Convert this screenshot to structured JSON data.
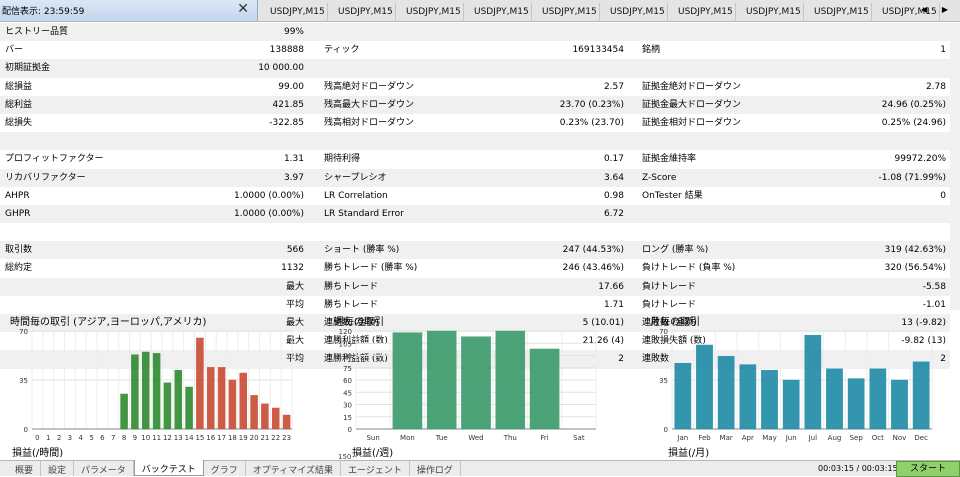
{
  "panel": {
    "title": "配信表示: 23:59:59",
    "close": "✕"
  },
  "chart_tabs": [
    "USDJPY,M15",
    "USDJPY,M15",
    "USDJPY,M15",
    "USDJPY,M15",
    "USDJPY,M15",
    "USDJPY,M15",
    "USDJPY,M15",
    "USDJPY,M15",
    "USDJPY,M15",
    "USDJPY,M15"
  ],
  "tab_arrows": "◀ ▶",
  "stats": {
    "rows": [
      {
        "alt": true,
        "cells": [
          "ヒストリー品質",
          "99%",
          "",
          "",
          "",
          ""
        ],
        "bar": true
      },
      {
        "alt": false,
        "cells": [
          "バー",
          "138888",
          "ティック",
          "169133454",
          "銘柄",
          "1"
        ]
      },
      {
        "alt": true,
        "cells": [
          "初期証拠金",
          "10 000.00",
          "",
          "",
          "",
          ""
        ]
      },
      {
        "alt": false,
        "cells": [
          "総損益",
          "99.00",
          "残高絶対ドローダウン",
          "2.57",
          "証拠金絶対ドローダウン",
          "2.78"
        ]
      },
      {
        "alt": true,
        "cells": [
          "総利益",
          "421.85",
          "残高最大ドローダウン",
          "23.70 (0.23%)",
          "証拠金最大ドローダウン",
          "24.96 (0.25%)"
        ]
      },
      {
        "alt": false,
        "cells": [
          "総損失",
          "-322.85",
          "残高相対ドローダウン",
          "0.23% (23.70)",
          "証拠金相対ドローダウン",
          "0.25% (24.96)"
        ]
      },
      {
        "alt": true,
        "cells": [
          "",
          "",
          "",
          "",
          "",
          ""
        ]
      },
      {
        "alt": false,
        "cells": [
          "プロフィットファクター",
          "1.31",
          "期待利得",
          "0.17",
          "証拠金維持率",
          "99972.20%"
        ]
      },
      {
        "alt": true,
        "cells": [
          "リカバリファクター",
          "3.97",
          "シャープレシオ",
          "3.64",
          "Z-Score",
          "-1.08 (71.99%)"
        ]
      },
      {
        "alt": false,
        "cells": [
          "AHPR",
          "1.0000 (0.00%)",
          "LR Correlation",
          "0.98",
          "OnTester 結果",
          "0"
        ]
      },
      {
        "alt": true,
        "cells": [
          "GHPR",
          "1.0000 (0.00%)",
          "LR Standard Error",
          "6.72",
          "",
          ""
        ]
      },
      {
        "alt": false,
        "cells": [
          "",
          "",
          "",
          "",
          "",
          ""
        ]
      },
      {
        "alt": true,
        "cells": [
          "取引数",
          "566",
          "ショート (勝率 %)",
          "247 (44.53%)",
          "ロング (勝率 %)",
          "319 (42.63%)"
        ]
      },
      {
        "alt": false,
        "cells": [
          "総約定",
          "1132",
          "勝ちトレード (勝率 %)",
          "246 (43.46%)",
          "負けトレード (負率 %)",
          "320 (56.54%)"
        ]
      },
      {
        "alt": true,
        "cells": [
          "",
          "最大",
          "勝ちトレード",
          "17.66",
          "負けトレード",
          "-5.58"
        ]
      },
      {
        "alt": false,
        "cells": [
          "",
          "平均",
          "勝ちトレード",
          "1.71",
          "負けトレード",
          "-1.01"
        ]
      },
      {
        "alt": true,
        "cells": [
          "",
          "最大",
          "連勝数 (金額)",
          "5 (10.01)",
          "連敗数 (金額)",
          "13 (-9.82)"
        ]
      },
      {
        "alt": false,
        "cells": [
          "",
          "最大",
          "連勝利益額 (数)",
          "21.26 (4)",
          "連敗損失額 (数)",
          "-9.82 (13)"
        ]
      },
      {
        "alt": true,
        "cells": [
          "",
          "平均",
          "連勝利益額 (数)",
          "2",
          "連敗数",
          "2"
        ]
      }
    ]
  },
  "chart_data": [
    {
      "type": "bar",
      "title": "時間毎の取引 (アジア,ヨーロッパ,アメリカ)",
      "bottom_label": "損益(/時間)",
      "categories": [
        "0",
        "1",
        "2",
        "3",
        "4",
        "5",
        "6",
        "7",
        "8",
        "9",
        "10",
        "11",
        "12",
        "13",
        "14",
        "15",
        "16",
        "17",
        "18",
        "19",
        "20",
        "21",
        "22",
        "23"
      ],
      "values": [
        0,
        0,
        0,
        0,
        0,
        0,
        0,
        0,
        25,
        53,
        55,
        54,
        33,
        42,
        30,
        65,
        44,
        44,
        35,
        40,
        24,
        18,
        15,
        10
      ],
      "colors": [
        "#2e8a2e",
        "#2e8a2e",
        "#2e8a2e",
        "#2e8a2e",
        "#2e8a2e",
        "#2e8a2e",
        "#2e8a2e",
        "#2e8a2e",
        "#2e8a2e",
        "#2e8a2e",
        "#2e8a2e",
        "#2e8a2e",
        "#2e8a2e",
        "#2e8a2e",
        "#2e8a2e",
        "#c94a32",
        "#c94a32",
        "#c94a32",
        "#c94a32",
        "#c94a32",
        "#c94a32",
        "#c94a32",
        "#c94a32",
        "#c94a32"
      ],
      "yticks": [
        0,
        35,
        70
      ],
      "ylim": [
        0,
        70
      ],
      "grid": true
    },
    {
      "type": "bar",
      "title": "週毎の取引",
      "bottom_label": "損益(/週)",
      "bottom_tick": "150",
      "categories": [
        "Sun",
        "Mon",
        "Tue",
        "Wed",
        "Thu",
        "Fri",
        "Sat"
      ],
      "values": [
        0,
        118,
        120,
        113,
        120,
        98,
        0
      ],
      "colors": [
        "#3a9a6a",
        "#3a9a6a",
        "#3a9a6a",
        "#3a9a6a",
        "#3a9a6a",
        "#3a9a6a",
        "#3a9a6a"
      ],
      "yticks": [
        0,
        15,
        30,
        45,
        60,
        75,
        90,
        105,
        120
      ],
      "ylim": [
        0,
        120
      ],
      "grid": true
    },
    {
      "type": "bar",
      "title": "月毎の取引",
      "bottom_label": "損益(/月)",
      "categories": [
        "Jan",
        "Feb",
        "Mar",
        "Apr",
        "May",
        "Jun",
        "Jul",
        "Aug",
        "Sep",
        "Oct",
        "Nov",
        "Dec"
      ],
      "values": [
        47,
        60,
        52,
        46,
        42,
        35,
        67,
        43,
        36,
        43,
        35,
        48
      ],
      "colors": [
        "#1f8aa6",
        "#1f8aa6",
        "#1f8aa6",
        "#1f8aa6",
        "#1f8aa6",
        "#1f8aa6",
        "#1f8aa6",
        "#1f8aa6",
        "#1f8aa6",
        "#1f8aa6",
        "#1f8aa6",
        "#1f8aa6"
      ],
      "yticks": [
        0,
        35,
        70
      ],
      "ylim": [
        0,
        70
      ],
      "grid": true
    }
  ],
  "bottom_tabs": [
    {
      "label": "概要",
      "active": false
    },
    {
      "label": "設定",
      "active": false
    },
    {
      "label": "パラメータ",
      "active": false
    },
    {
      "label": "バックテスト",
      "active": true
    },
    {
      "label": "グラフ",
      "active": false
    },
    {
      "label": "オプティマイズ結果",
      "active": false
    },
    {
      "label": "エージェント",
      "active": false
    },
    {
      "label": "操作ログ",
      "active": false
    }
  ],
  "status": {
    "time": "00:03:15 / 00:03:15",
    "start_label": "スタート"
  },
  "colors": {
    "quality_bar": "#9cf07e",
    "start_button": "#8fd06b"
  }
}
